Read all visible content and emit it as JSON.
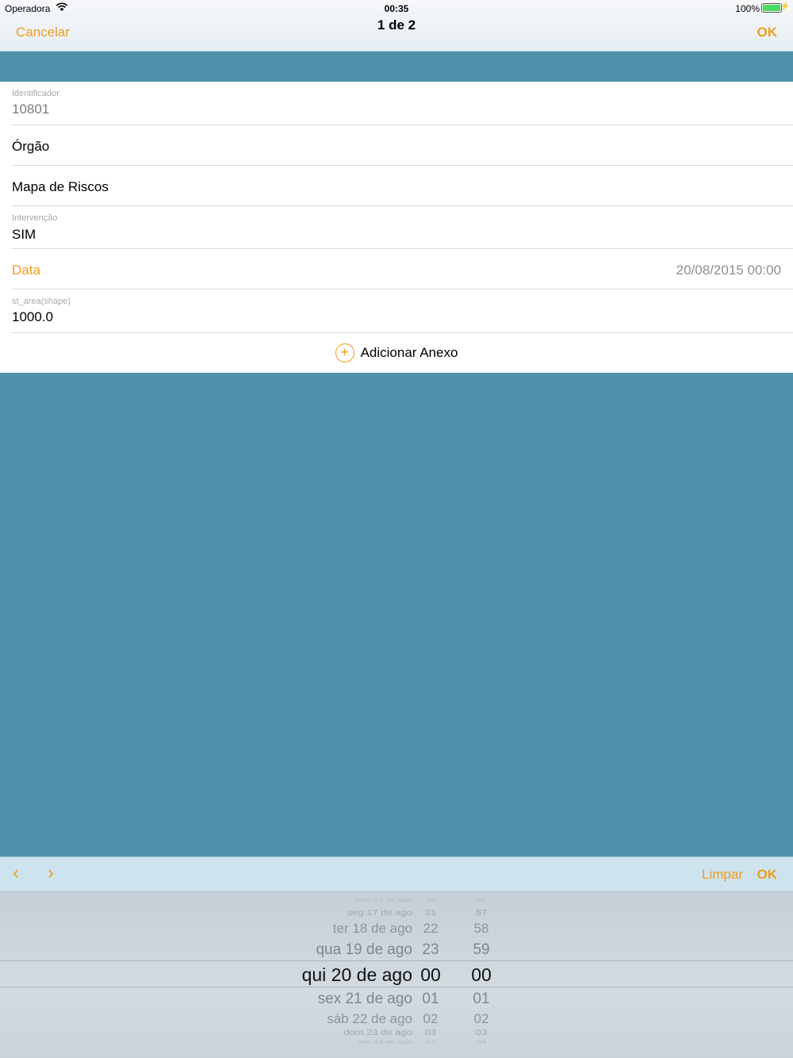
{
  "status_bar": {
    "carrier": "Operadora",
    "time": "00:35",
    "battery": "100%"
  },
  "nav": {
    "cancel": "Cancelar",
    "title": "1 de 2",
    "ok": "OK"
  },
  "form": {
    "identificador": {
      "label": "Identificador",
      "value": "10801"
    },
    "orgao": {
      "label": "Órgão"
    },
    "mapa": {
      "label": "Mapa de Riscos"
    },
    "intervencao": {
      "label": "Intervenção",
      "value": "SIM"
    },
    "data": {
      "label": "Data",
      "value": "20/08/2015 00:00"
    },
    "st_area": {
      "label": "st_area(shape)",
      "value": "1000.0"
    },
    "attach": {
      "label": "Adicionar Anexo"
    }
  },
  "accessory": {
    "limpar": "Limpar",
    "ok": "OK"
  },
  "picker": {
    "dates": [
      "dom 16 de ago",
      "seg 17 de ago",
      "ter 18 de ago",
      "qua 19 de ago",
      "qui 20 de ago",
      "sex 21 de ago",
      "sáb 22 de ago",
      "dom 23 de ago",
      "seg 24 de ago"
    ],
    "hours": [
      "20",
      "21",
      "22",
      "23",
      "00",
      "01",
      "02",
      "03",
      "04"
    ],
    "minutes": [
      "56",
      "57",
      "58",
      "59",
      "00",
      "01",
      "02",
      "03",
      "04"
    ],
    "selected_index": 4
  },
  "colors": {
    "accent": "#f29c1f",
    "background": "#5090ab",
    "accessory_bar": "#cde4ef"
  }
}
